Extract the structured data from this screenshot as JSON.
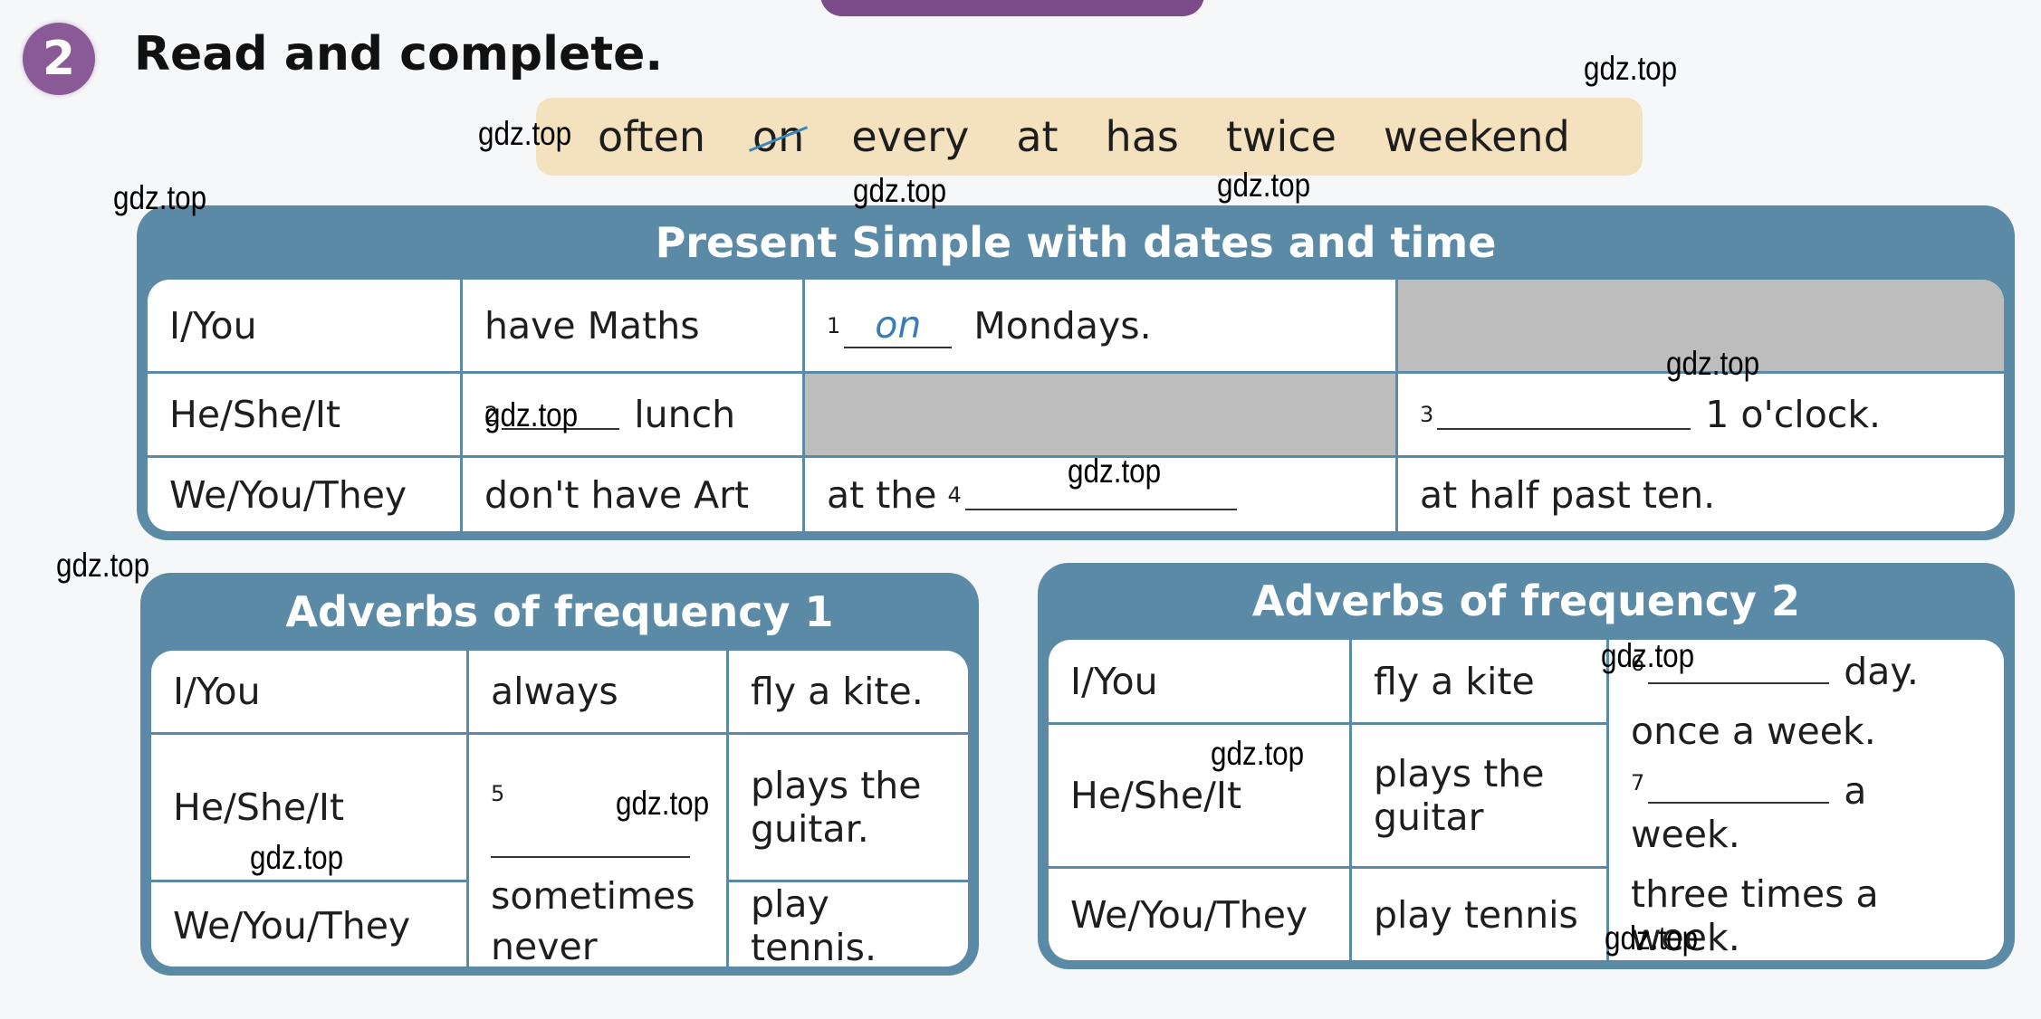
{
  "exercise": {
    "number": "2",
    "title": "Read and complete."
  },
  "word_bank": [
    "often",
    "on",
    "every",
    "at",
    "has",
    "twice",
    "weekend"
  ],
  "word_bank_crossed": "on",
  "table1": {
    "title": "Present Simple with dates and time",
    "rows": [
      {
        "subject": "I/You",
        "verb": "have Maths",
        "c3_num": "1",
        "c3_answer": "on",
        "c3_text": "Mondays.",
        "c4_text": ""
      },
      {
        "subject": "He/She/It",
        "verb_num": "2",
        "verb_text": "lunch",
        "c4_num": "3",
        "c4_text": "1 o'clock."
      },
      {
        "subject": "We/You/They",
        "verb": "don't have Art",
        "c3_prefix": "at the",
        "c3_num": "4",
        "c4_text": "at half past ten."
      }
    ]
  },
  "table2": {
    "title": "Adverbs of frequency 1",
    "subjects": [
      "I/You",
      "He/She/It",
      "We/You/They"
    ],
    "adverb1": "always",
    "adverb_num": "5",
    "adverb2": "sometimes",
    "adverb3": "never",
    "actions": [
      "fly a kite.",
      "plays the guitar.",
      "play tennis."
    ]
  },
  "table3": {
    "title": "Adverbs of frequency 2",
    "subjects": [
      "I/You",
      "He/She/It",
      "We/You/They"
    ],
    "actions": [
      "fly a kite",
      "plays the guitar",
      "play tennis"
    ],
    "freq": [
      {
        "num": "6",
        "text": "day."
      },
      {
        "text": "once a week."
      },
      {
        "num": "7",
        "text": "a week."
      },
      {
        "text": "three times a week."
      }
    ]
  },
  "watermark": "gdz.top",
  "colors": {
    "table_header": "#5b8aa7",
    "word_bank": "#f4e2bf",
    "badge": "#8a5a97",
    "answer": "#3a7bb8",
    "gray_cell": "#bdbdbd"
  }
}
